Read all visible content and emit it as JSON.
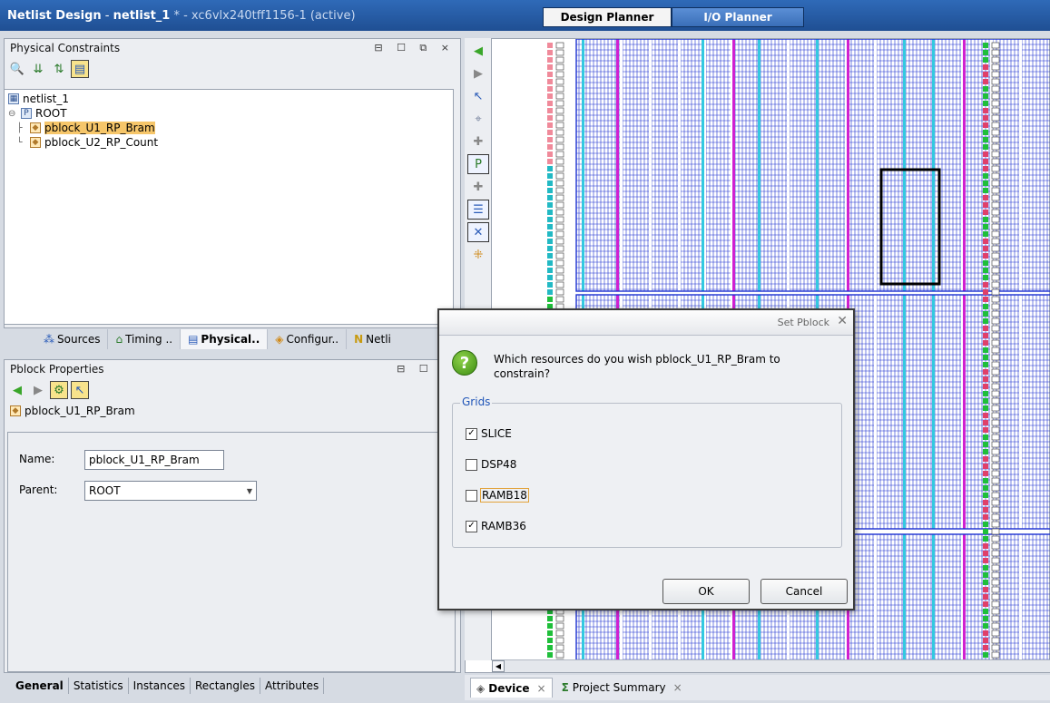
{
  "window": {
    "title_app": "Netlist Design",
    "title_sep": " - ",
    "title_netlist": "netlist_1",
    "title_rest": " * - xc6vlx240tff1156-1 (active)"
  },
  "planner_tabs": {
    "design": "Design Planner",
    "io": "I/O Planner"
  },
  "physical_constraints": {
    "title": "Physical Constraints",
    "ctrls": "⊟ ☐ ⧉ ×",
    "tree": {
      "root_file": "netlist_1",
      "root": "ROOT",
      "item1": "pblock_U1_RP_Bram",
      "item2": "pblock_U2_RP_Count"
    }
  },
  "left_tabs": {
    "sources": "Sources",
    "timing": "Timing ..",
    "physical": "Physical..",
    "configur": "Configur..",
    "netlist": "Netli"
  },
  "pblock_properties": {
    "title": "Pblock Properties",
    "ctrls": "⊟ ☐ ⧉",
    "selected": "pblock_U1_RP_Bram",
    "name_label": "Name:",
    "name_value": "pblock_U1_RP_Bram",
    "parent_label": "Parent:",
    "parent_value": "ROOT"
  },
  "bottom_tabs": {
    "general": "General",
    "statistics": "Statistics",
    "instances": "Instances",
    "rectangles": "Rectangles",
    "attributes": "Attributes"
  },
  "device_tabs": {
    "device": "Device",
    "summary": "Project Summary",
    "close": "×"
  },
  "dialog": {
    "title": "Set Pblock",
    "question": "Which resources do you wish pblock_U1_RP_Bram to constrain?",
    "group": "Grids",
    "options": [
      {
        "label": "SLICE",
        "checked": true
      },
      {
        "label": "DSP48",
        "checked": false
      },
      {
        "label": "RAMB18",
        "checked": false
      },
      {
        "label": "RAMB36",
        "checked": true
      }
    ],
    "ok": "OK",
    "cancel": "Cancel"
  },
  "colors": {
    "title_bg": "#1f4f93",
    "grid_blue": "#1b2fd0",
    "magenta": "#d020d0",
    "cyan": "#33c9e0",
    "selected_tree": "#f6c66a"
  }
}
